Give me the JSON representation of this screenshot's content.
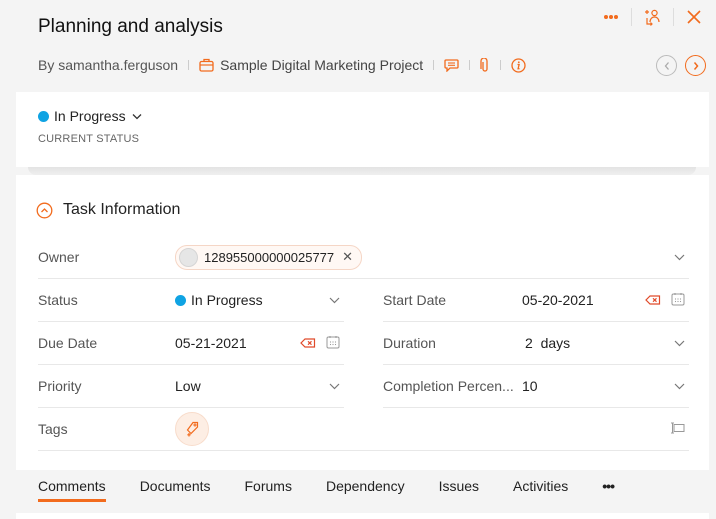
{
  "header": {
    "title": "Planning and analysis",
    "author": "By samantha.ferguson",
    "project": "Sample Digital Marketing Project",
    "icons": [
      "more-icon",
      "follow-user-icon",
      "close-icon",
      "comment-icon",
      "attachment-icon",
      "info-icon",
      "prev-icon",
      "next-icon"
    ]
  },
  "status_card": {
    "status": "In Progress",
    "status_color": "#0fa3e3",
    "caption": "CURRENT STATUS"
  },
  "task_info": {
    "title": "Task Information",
    "owner_label": "Owner",
    "owner_value": "128955000000025777",
    "status_label": "Status",
    "status_value": "In Progress",
    "start_date_label": "Start Date",
    "start_date_value": "05-20-2021",
    "due_date_label": "Due Date",
    "due_date_value": "05-21-2021",
    "duration_label": "Duration",
    "duration_value": "2  days",
    "priority_label": "Priority",
    "priority_value": "Low",
    "completion_label": "Completion Percen...",
    "completion_value": "10",
    "tags_label": "Tags"
  },
  "tabs": [
    {
      "label": "Comments",
      "active": true
    },
    {
      "label": "Documents"
    },
    {
      "label": "Forums"
    },
    {
      "label": "Dependency"
    },
    {
      "label": "Issues"
    },
    {
      "label": "Activities"
    },
    {
      "label": "•••"
    }
  ],
  "colors": {
    "accent": "#f26b1d",
    "status_blue": "#0fa3e3"
  }
}
